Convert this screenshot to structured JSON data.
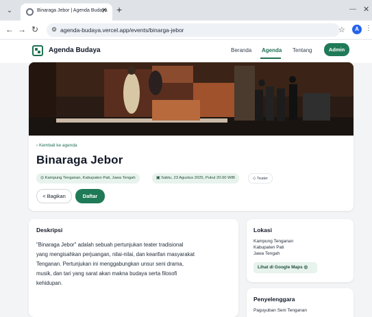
{
  "browser": {
    "tab_title": "Binaraga Jebor | Agenda Budaya",
    "tab_close": "✕",
    "new_tab": "+",
    "url": "agenda-budaya.vercel.app/events/binarga-jebor",
    "profile_initial": "A"
  },
  "header": {
    "brand": "Agenda Budaya",
    "nav": [
      "Beranda",
      "Agenda",
      "Tentang"
    ],
    "admin_label": "Admin"
  },
  "event": {
    "back_label": "‹ Kembali ke agenda",
    "title": "Binaraga Jebor",
    "location_chip": "Kampung Tenganan, Kabupaten Pati, Jawa Tengah",
    "date_chip": "Sabtu, 23 Agustus 2025, Pukul 20.00 WIB",
    "category_chip": "Teater",
    "share_label": "Bagikan",
    "register_label": "Daftar"
  },
  "description": {
    "heading": "Deskripsi",
    "lines": [
      "\"Binaraga Jebor\" adalah sebuah pertunjukan teater tradisional",
      "yang mengisahkan perjuangan, nilai-nilai, dan kearifan masyarakat",
      "Tenganan. Pertunjukan ini menggabungkan unsur seni drama,",
      "musik, dan tari yang sarat akan makna budaya serta filosofi",
      "kehidupan."
    ]
  },
  "location": {
    "heading": "Lokasi",
    "lines": [
      "Kampung Tenganan",
      "Kabupaten Pati",
      "Jawa Tengah"
    ],
    "maps_label": "Lihat di Google Maps"
  },
  "organizer": {
    "heading": "Penyelenggara",
    "name": "Paguyuban Seni Tenganan"
  },
  "colors": {
    "brand_green": "#1f7a57",
    "chip_bg": "#e7f3ec"
  }
}
